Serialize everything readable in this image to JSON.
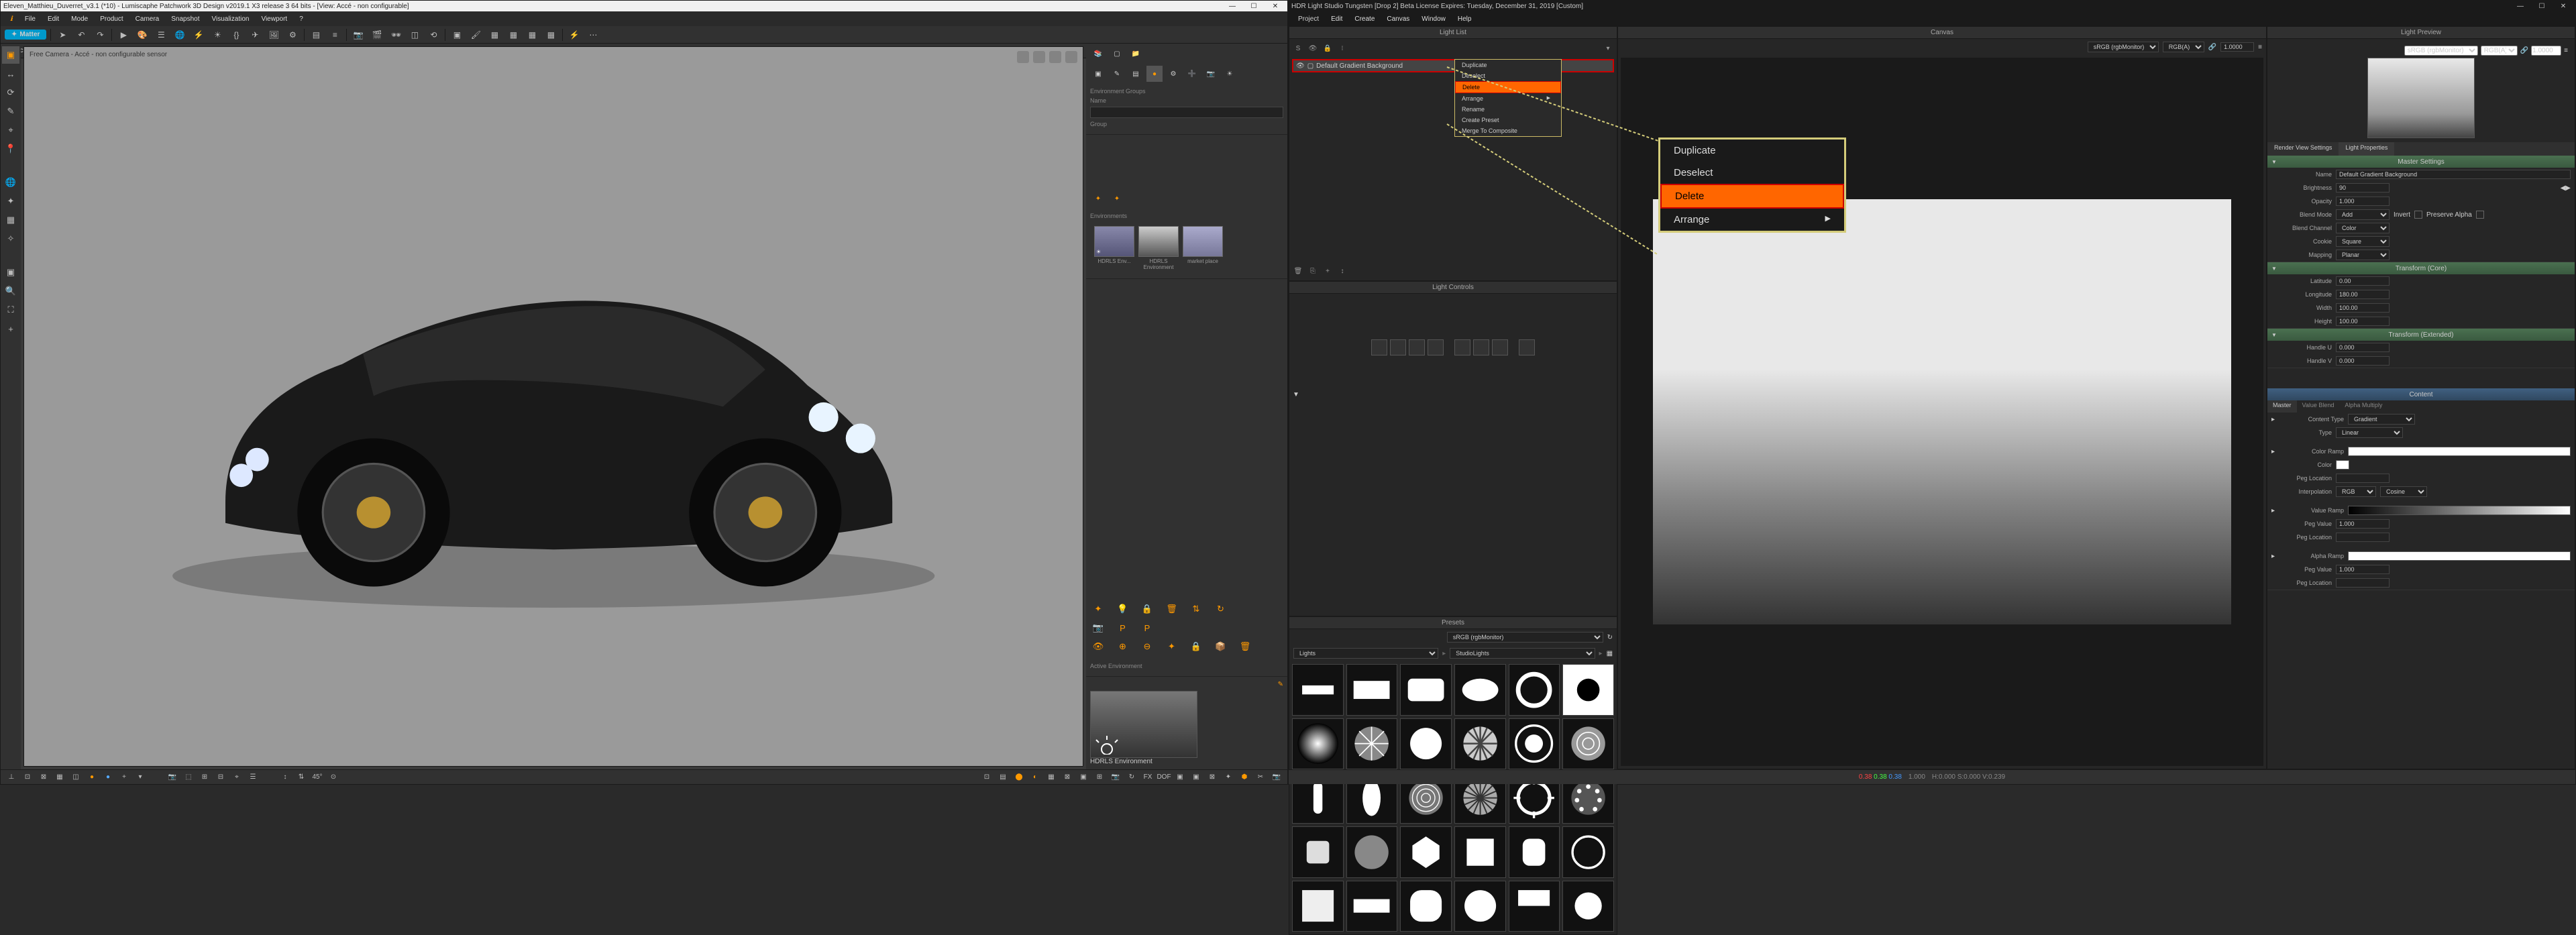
{
  "left": {
    "title": "Eleven_Matthieu_Duverret_v3.1 (*10) - Lumiscaphe Patchwork 3D Design v2019.1 X3 release 3  64 bits - [View: Accé - non configurable]",
    "winControls": [
      "—",
      "☐",
      "✕"
    ],
    "menu": [
      "ℹ",
      "File",
      "Edit",
      "Mode",
      "Product",
      "Camera",
      "Snapshot",
      "Visualization",
      "Viewport",
      "?"
    ],
    "matterLabel": "Matter",
    "modebar": {
      "status": "Accé   non configurable"
    },
    "viewLabel": "Free Camera - Accé - non configurable sensor",
    "envGroups": {
      "hdr": "Environment Groups",
      "name": "Name",
      "group": "Group"
    },
    "envSect": "Environments",
    "envThumbs": [
      {
        "label": "HDRLS Env..."
      },
      {
        "label": "HDRLS Environment"
      },
      {
        "label": "market place"
      }
    ],
    "activeEnv": {
      "hdr": "Active Environment",
      "label": "HDRLS Environment"
    }
  },
  "right": {
    "title": "HDR Light Studio Tungsten [Drop 2] Beta License Expires: Tuesday, December 31, 2019  [Custom]",
    "winControls": [
      "—",
      "☐",
      "✕"
    ],
    "menu": [
      "Project",
      "Edit",
      "Create",
      "Canvas",
      "Window",
      "Help"
    ],
    "panels": {
      "lightList": "Light List",
      "lightControls": "Light Controls",
      "presets": "Presets",
      "canvas": "Canvas",
      "lightPreview": "Light Preview",
      "renderView": "Render View Settings",
      "lightProps": "Light Properties"
    },
    "selectedLight": "Default Gradient Background",
    "ctxMenu": [
      "Duplicate",
      "Deselect",
      "Delete",
      "Arrange",
      "Rename",
      "Create Preset",
      "Merge To Composite"
    ],
    "zoomMenu": [
      "Duplicate",
      "Deselect",
      "Delete",
      "Arrange"
    ],
    "canvasBar": {
      "cs": "sRGB (rgbMonitor)",
      "mode": "RGB(A)",
      "val": "1.0000"
    },
    "previewBar": {
      "cs": "sRGB (rgbMonitor)",
      "mode": "RGB(A)",
      "val": "1.0000"
    },
    "presetsTabs": {
      "a": "Lights",
      "b": "StudioLights"
    },
    "propTabs": {
      "a": "Render View Settings",
      "b": "Light Properties"
    },
    "master": {
      "hdr": "Master Settings",
      "name": "Name",
      "nameVal": "Default Gradient Background",
      "brightness": "Brightness",
      "brightnessVal": "90",
      "opacity": "Opacity",
      "opacityVal": "1.000",
      "blendMode": "Blend Mode",
      "blendModeVal": "Add",
      "invert": "Invert",
      "preserveAlpha": "Preserve Alpha",
      "blendChannel": "Blend Channel",
      "blendChannelVal": "Color",
      "cookie": "Cookie",
      "cookieVal": "Square",
      "mapping": "Mapping",
      "mappingVal": "Planar"
    },
    "tcore": {
      "hdr": "Transform (Core)",
      "latitude": "Latitude",
      "latitudeVal": "0.00",
      "longitude": "Longitude",
      "longitudeVal": "180.00",
      "width": "Width",
      "widthVal": "100.00",
      "height": "Height",
      "heightVal": "100.00"
    },
    "text": {
      "hdr": "Transform (Extended)",
      "handleU": "Handle U",
      "handleUVal": "0.000",
      "handleV": "Handle V",
      "handleVVal": "0.000"
    },
    "content": {
      "hdr": "Content",
      "subtabs": [
        "Master",
        "Value Blend",
        "Alpha Multiply"
      ],
      "contentType": "Content Type",
      "contentTypeVal": "Gradient",
      "type": "Type",
      "typeVal": "Linear",
      "colorRamp": "Color Ramp",
      "color": "Color",
      "pegLocation": "Peg Location",
      "interpolation": "Interpolation",
      "interpA": "RGB",
      "interpB": "Cosine",
      "valueRamp": "Value Ramp",
      "pegValue": "Peg Value",
      "pegValueVal": "1.000",
      "alphaRamp": "Alpha Ramp"
    },
    "status": {
      "rgb": "0.38 0.38 0.38",
      "lum": "1.000",
      "hsv": "H:0.000 S:0.000 V:0.239"
    }
  }
}
